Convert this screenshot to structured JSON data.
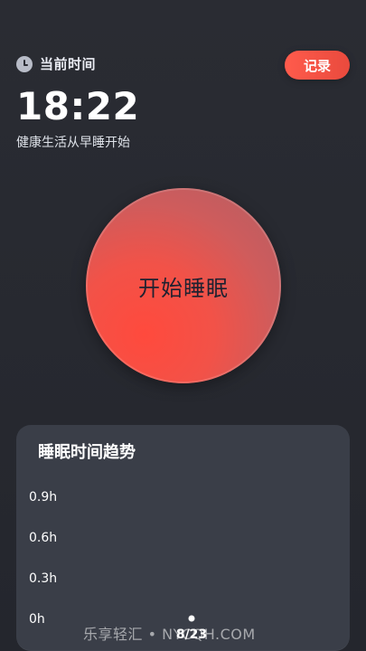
{
  "header": {
    "current_label": "当前时间",
    "record_label": "记录",
    "clock_icon": "clock-icon"
  },
  "time": "18:22",
  "tagline": "健康生活从早睡开始",
  "sleep_button": {
    "label": "开始睡眠"
  },
  "trend": {
    "title": "睡眠时间趋势"
  },
  "chart_data": {
    "type": "scatter",
    "title": "睡眠时间趋势",
    "y_ticks": [
      "0.9h",
      "0.6h",
      "0.3h",
      "0h"
    ],
    "ylim": [
      0,
      0.9
    ],
    "categories": [
      "8/23"
    ],
    "values": [
      0
    ],
    "grid": false
  },
  "watermark": "乐享轻汇 • NYCQH.COM",
  "colors": {
    "accent": "#F25248",
    "background": "#2A2C33",
    "card": "#3A3E48"
  }
}
